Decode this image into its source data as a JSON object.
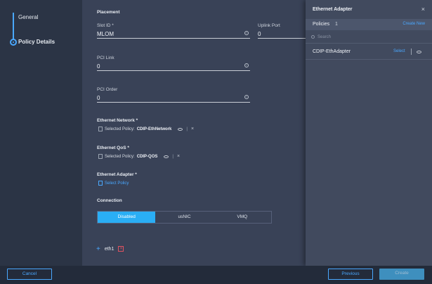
{
  "stepper": {
    "steps": [
      {
        "label": "General"
      },
      {
        "label": "Policy Details"
      }
    ]
  },
  "form": {
    "placement_title": "Placement",
    "slot_id_label": "Slot ID *",
    "slot_id_value": "MLOM",
    "uplink_port_label": "Uplink Port",
    "uplink_port_value": "0",
    "pci_link_label": "PCI Link",
    "pci_link_value": "0",
    "pci_order_label": "PCI Order",
    "pci_order_value": "0",
    "ethernet_network": {
      "label": "Ethernet Network *",
      "prefix": "Selected Policy:",
      "name": "CDIP-EthNetwork"
    },
    "ethernet_qos": {
      "label": "Ethernet QoS *",
      "prefix": "Selected Policy:",
      "name": "CDIP-QOS"
    },
    "ethernet_adapter": {
      "label": "Ethernet Adapter *",
      "link": "Select Policy"
    },
    "connection": {
      "label": "Connection",
      "options": [
        "Disabled",
        "usNIC",
        "VMQ"
      ],
      "selected": "Disabled"
    },
    "interface_name": "eth1"
  },
  "drawer": {
    "title": "Ethernet Adapter",
    "policies_label": "Policies",
    "policies_count": "1",
    "create_new": "Create New",
    "search_placeholder": "Search",
    "items": [
      {
        "name": "CDIP-EthAdapter",
        "action": "Select"
      }
    ]
  },
  "footer": {
    "cancel": "Cancel",
    "previous": "Previous",
    "create": "Create"
  },
  "colors": {
    "accent": "#2aaef5",
    "link": "#4aa8ff",
    "delete": "#e05260"
  }
}
